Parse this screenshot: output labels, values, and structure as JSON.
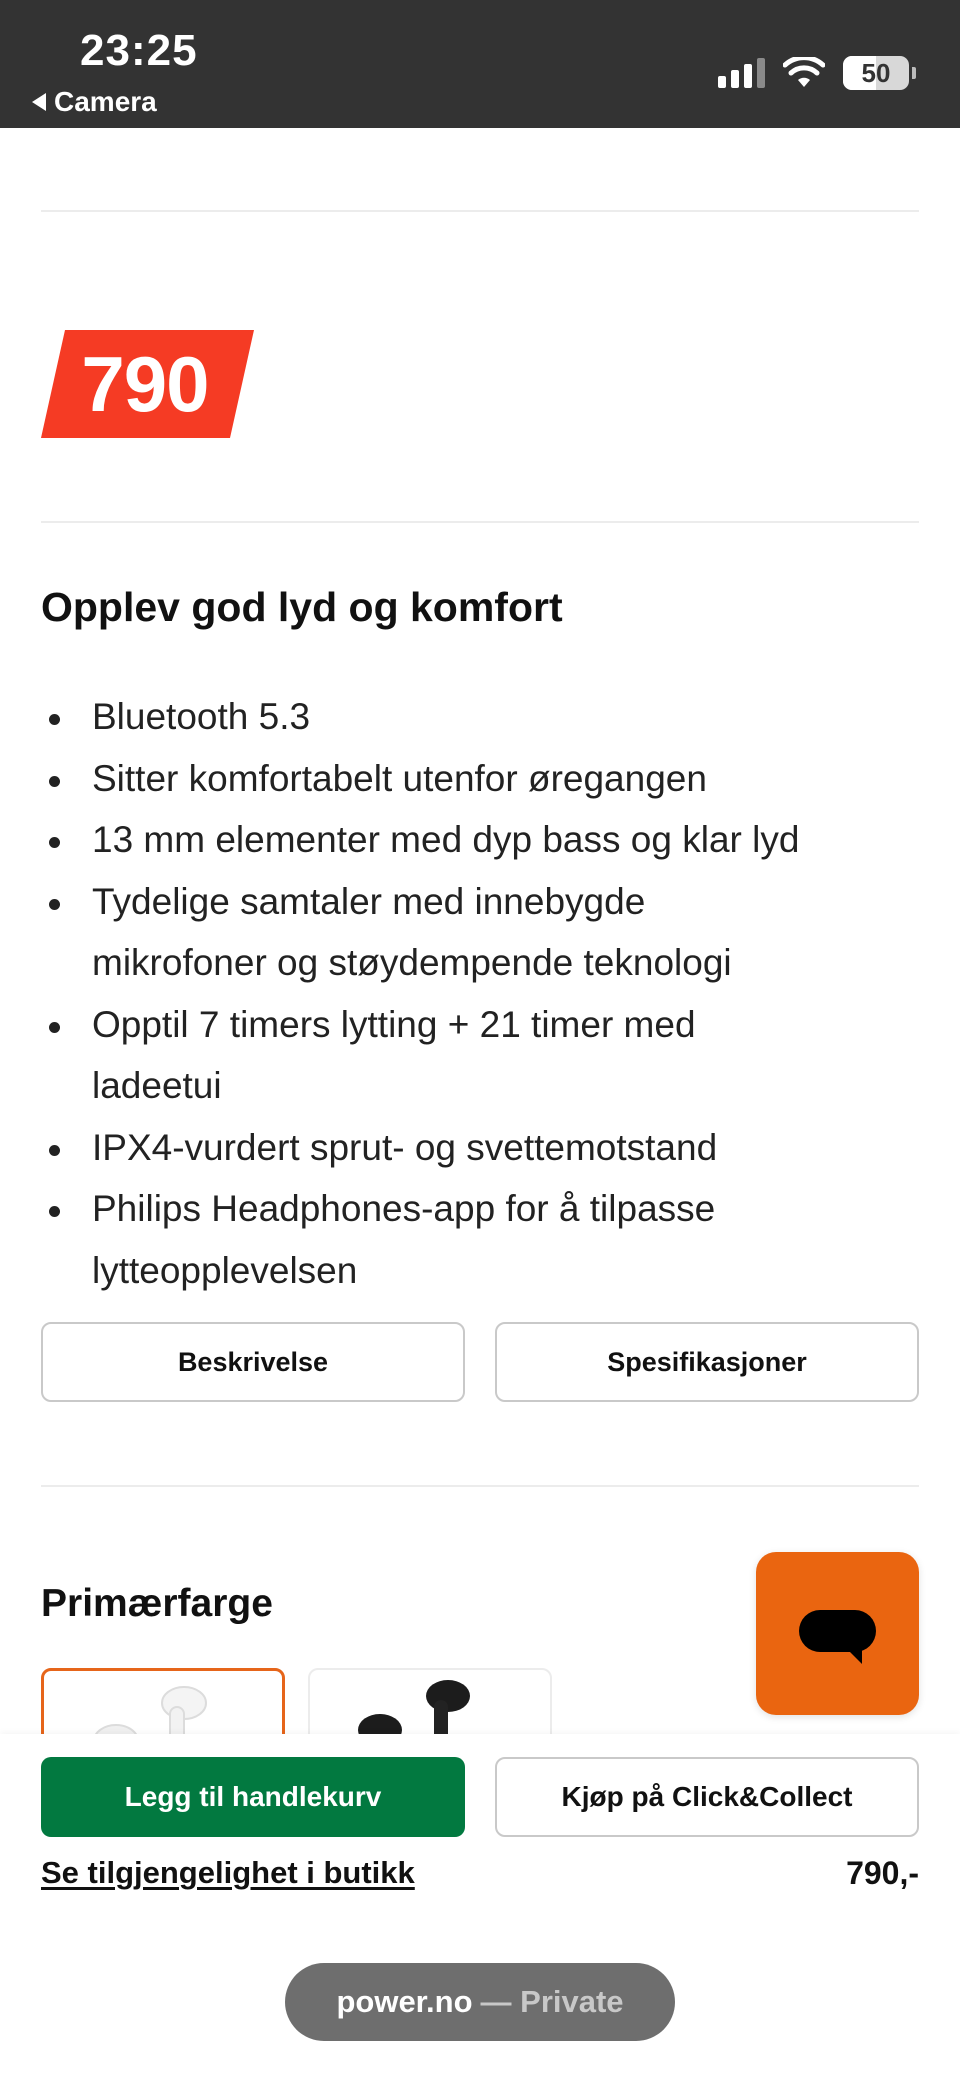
{
  "status_bar": {
    "time": "23:25",
    "back_label": "Camera",
    "battery": "50",
    "battery_level": 0.5
  },
  "product": {
    "price_badge": "790",
    "heading": "Opplev god lyd og komfort",
    "features": [
      "Bluetooth 5.3",
      "Sitter komfortabelt utenfor øregangen",
      "13 mm elementer med dyp bass og klar lyd",
      "Tydelige samtaler med innebygde mikrofoner og støydempende teknologi",
      "Opptil 7 timers lytting + 21 timer med ladeetui",
      "IPX4-vurdert sprut- og svettemotstand",
      "Philips Headphones-app for å tilpasse lytteopplevelsen"
    ],
    "description_button": "Beskrivelse",
    "specifications_button": "Spesifikasjoner",
    "color_label": "Primærfarge",
    "color_options": [
      "white-earbuds",
      "black-earbuds"
    ],
    "selected_color": "white-earbuds"
  },
  "purchase_bar": {
    "add_to_cart": "Legg til handlekurv",
    "click_collect": "Kjøp på Click&Collect",
    "store_availability": "Se tilgjengelighet i butikk",
    "price": "790,-"
  },
  "browser": {
    "domain": "power.no",
    "mode": "— Private"
  },
  "colors": {
    "status_bar_bg": "#333333",
    "price_badge_bg": "#f53b24",
    "primary_button_bg": "#027940",
    "chat_button_bg": "#ea6510",
    "selected_swatch_border": "#e6651a"
  },
  "icons": {
    "back": "back-arrow-icon",
    "signal": "cellular-signal-icon",
    "wifi": "wifi-icon",
    "battery": "battery-icon",
    "chat": "chat-bubble-icon"
  }
}
